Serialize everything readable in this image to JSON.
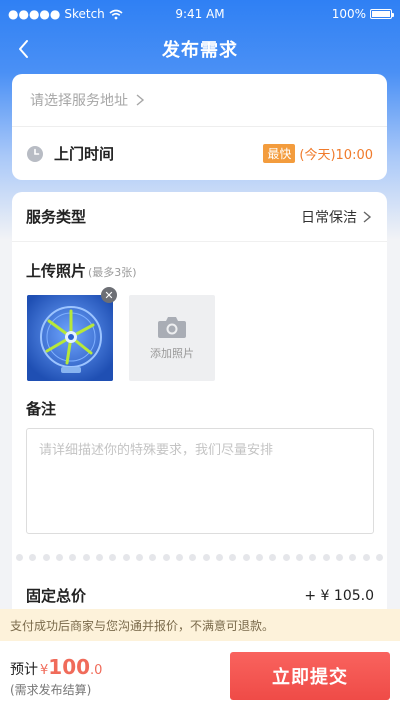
{
  "status_bar": {
    "carrier": "Sketch",
    "time": "9:41 AM",
    "battery": "100%"
  },
  "nav": {
    "title": "发布需求",
    "back_icon": "chevron-left-icon"
  },
  "address": {
    "placeholder": "请选择服务地址",
    "chevron": "›"
  },
  "visit_time": {
    "label": "上门时间",
    "tag": "最快",
    "value": "(今天)10:00"
  },
  "service": {
    "label": "服务类型",
    "value": "日常保洁",
    "chevron": "›"
  },
  "upload": {
    "title": "上传照片",
    "hint": "(最多3张)",
    "add_label": "添加照片",
    "remove": "✕"
  },
  "remark": {
    "title": "备注",
    "placeholder": "请详细描述你的特殊要求，我们尽量安排",
    "value": ""
  },
  "fixed_price": {
    "label": "固定总价",
    "value": "+ ¥ 105.0"
  },
  "notice": "支付成功后商家与您沟通并报价，不满意可退款。",
  "footer": {
    "estimate_label": "预计",
    "currency": "¥",
    "amount_int": "100",
    "amount_dec": ".0",
    "note": "(需求发布结算)",
    "submit": "立即提交"
  },
  "colors": {
    "brand_blue": "#2f80f4",
    "tag_orange": "#f39c3d",
    "price_red": "#f06b5a",
    "submit_red": "#ef4b47",
    "notice_bg": "#fdf2da"
  }
}
